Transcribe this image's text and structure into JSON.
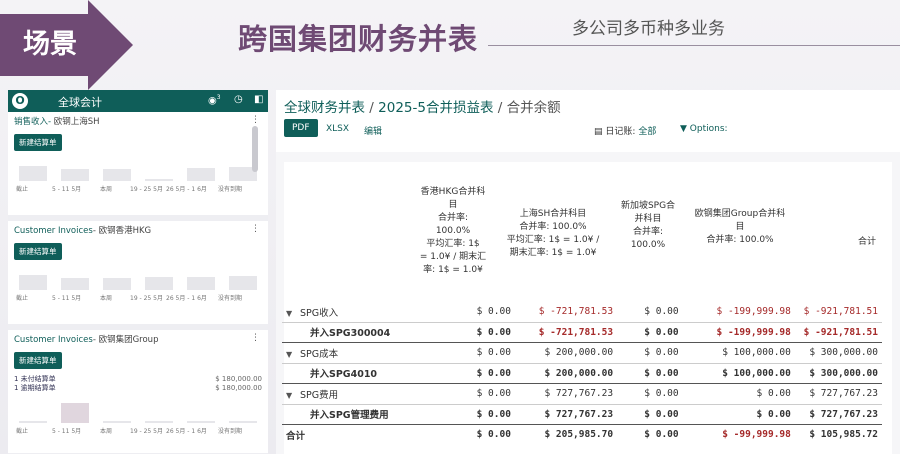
{
  "banner": {
    "tag": "场景",
    "title": "跨国集团财务并表",
    "subtitle": "多公司多币种多业务",
    "accent": "#6f4a74"
  },
  "mobile": {
    "app_title": "全球会计",
    "chat_badge": "3",
    "brand_color": "#0f5e59",
    "cards": [
      {
        "title_prefix": "销售收入- ",
        "title_suffix": "欧钢上海SH",
        "new_button": "新建结算单",
        "labels": [
          "截止",
          "5 - 11 5月",
          "本周",
          "19 - 25 5月",
          "26 5月 - 1 6月",
          "没有到期"
        ],
        "levels": [
          0.7,
          0.55,
          0.55,
          0.1,
          0.6,
          0.65
        ],
        "accounts": []
      },
      {
        "title_prefix": "Customer Invoices",
        "title_suffix": "- 欧钢香港HKG",
        "new_button": "新建结算单",
        "labels": [
          "截止",
          "5 - 11 5月",
          "本周",
          "19 - 25 5月",
          "26 5月 - 1 6月",
          "没有到期"
        ],
        "levels": [
          0.7,
          0.55,
          0.55,
          0.6,
          0.6,
          0.65
        ],
        "accounts": []
      },
      {
        "title_prefix": "Customer Invoices",
        "title_suffix": "- 欧钢集团Group",
        "new_button": "新建结算单",
        "labels": [
          "截止",
          "5 - 11 5月",
          "本周",
          "19 - 25 5月",
          "26 5月 - 1 6月",
          "没有到期"
        ],
        "levels": [
          0.1,
          0.9,
          0.1,
          0.1,
          0.1,
          0.1
        ],
        "accounts": [
          {
            "label": "1 未付结算单",
            "amount": "$ 180,000.00"
          },
          {
            "label": "1 逾期结算单",
            "amount": "$ 180,000.00"
          }
        ]
      }
    ]
  },
  "report": {
    "breadcrumb": [
      "全球财务并表",
      "2025-5合并损益表",
      "合并余额"
    ],
    "sep": " / ",
    "toolbar": {
      "pdf": "PDF",
      "xlsx": "XLSX",
      "edit": "编辑",
      "journal_label": "日记账:",
      "journal_value": "全部",
      "options": "Options:"
    },
    "columns": [
      {
        "name": "香港HKG合并科目",
        "lines": [
          "香港HKG合并科",
          "目",
          "合并率:",
          "100.0%",
          "平均汇率:   1$",
          "= 1.0¥ / 期末汇",
          "率:   1$ = 1.0¥"
        ]
      },
      {
        "name": "上海SH合并科目",
        "lines": [
          "上海SH合并科目",
          "合并率:   100.0%",
          "平均汇率:   1$ = 1.0¥ /",
          "期末汇率:   1$ = 1.0¥"
        ]
      },
      {
        "name": "新加坡SPG合并科目",
        "lines": [
          "新加坡SPG合",
          "并科目",
          "合并率:",
          "100.0%"
        ]
      },
      {
        "name": "欧钢集团Group合并科目",
        "lines": [
          "欧钢集团Group合并科",
          "目",
          "合并率:   100.0%"
        ]
      },
      {
        "name": "合计",
        "lines": [
          "合计"
        ]
      }
    ],
    "rows": [
      {
        "label": "SPG收入",
        "kind": "sec",
        "values": [
          "$ 0.00",
          "$ -721,781.53",
          "$ 0.00",
          "$ -199,999.98",
          "$ -921,781.51"
        ]
      },
      {
        "label": "并入SPG300004",
        "kind": "sub",
        "values": [
          "$ 0.00",
          "$ -721,781.53",
          "$ 0.00",
          "$ -199,999.98",
          "$ -921,781.51"
        ]
      },
      {
        "label": "SPG成本",
        "kind": "sec",
        "values": [
          "$ 0.00",
          "$ 200,000.00",
          "$ 0.00",
          "$ 100,000.00",
          "$ 300,000.00"
        ]
      },
      {
        "label": "并入SPG4010",
        "kind": "sub",
        "values": [
          "$ 0.00",
          "$ 200,000.00",
          "$ 0.00",
          "$ 100,000.00",
          "$ 300,000.00"
        ]
      },
      {
        "label": "SPG费用",
        "kind": "sec",
        "values": [
          "$ 0.00",
          "$ 727,767.23",
          "$ 0.00",
          "$ 0.00",
          "$ 727,767.23"
        ]
      },
      {
        "label": "并入SPG管理费用",
        "kind": "sub",
        "values": [
          "$ 0.00",
          "$ 727,767.23",
          "$ 0.00",
          "$ 0.00",
          "$ 727,767.23"
        ]
      },
      {
        "label": "合计",
        "kind": "tot",
        "values": [
          "$ 0.00",
          "$ 205,985.70",
          "$ 0.00",
          "$ -99,999.98",
          "$ 105,985.72"
        ]
      }
    ]
  }
}
